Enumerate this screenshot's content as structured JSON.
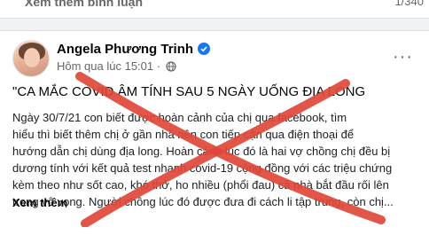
{
  "previous_post": {
    "link_label": "Xem thêm bình luận",
    "comment_count": "1/340"
  },
  "post": {
    "author_name": "Angela Phương Trinh",
    "timestamp": "Hôm qua lúc 15:01",
    "headline": "\"CA MẮC COVID ÂM TÍNH SAU 5 NGÀY UỐNG ĐỊA LONG",
    "body_lines": [
      "Ngày 30/7/21 con biết được hoàn cảnh của chị qua facebook, tìm",
      "hiểu thì biết thêm chị ở gần nhà nên con tiếp cận qua điện thoại để",
      "hướng dẫn chị dùng địa long. Hoàn cảnh lúc đó là hai vợ chồng chị đều bị",
      "dương tính với kết quả test nhanh covid-19 cộng đồng với các triệu chứng",
      "kèm theo như sốt cao, khó thở, ho nhiều (phổi đau) cả nhà bắt đầu rối lên",
      "trong vô vọng. Người chồng lúc đó được đưa đi cách li tập trung, còn chị..."
    ],
    "see_more_label": "Xem thêm"
  },
  "colors": {
    "overlay_cross": "#e0463a",
    "verified_badge": "#1877f2"
  },
  "icons": [
    "verified-badge-icon",
    "globe-icon",
    "more-options-icon"
  ]
}
